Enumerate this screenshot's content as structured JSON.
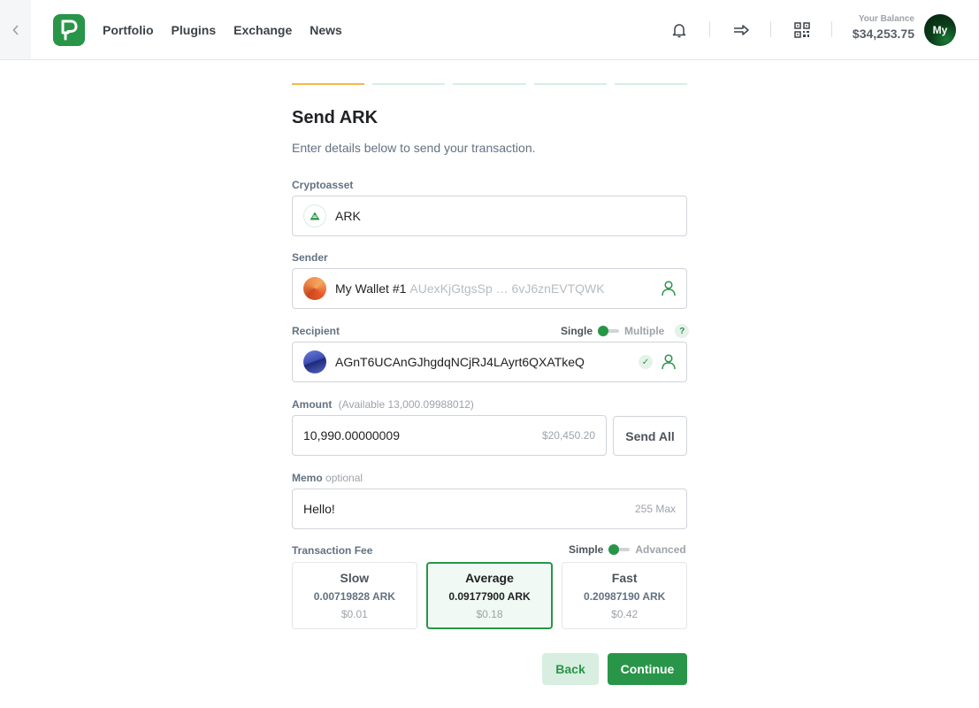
{
  "header": {
    "nav": [
      "Portfolio",
      "Plugins",
      "Exchange",
      "News"
    ],
    "balance_label": "Your Balance",
    "balance_value": "$34,253.75",
    "avatar_initials": "My",
    "brand_color": "#289548"
  },
  "page": {
    "title": "Send ARK",
    "subtitle": "Enter details below to send your transaction.",
    "steps_total": 5,
    "step_active": 1
  },
  "cryptoasset": {
    "label": "Cryptoasset",
    "value": "ARK"
  },
  "sender": {
    "label": "Sender",
    "wallet_name": "My Wallet #1",
    "address": "AUexKjGtgsSp … 6vJ6znEVTQWK"
  },
  "recipient": {
    "label": "Recipient",
    "toggle_on": "Single",
    "toggle_off": "Multiple",
    "help": "?",
    "address": "AGnT6UCAnGJhgdqNCjRJ4LAyrt6QXATkeQ"
  },
  "amount": {
    "label": "Amount",
    "available": "(Available 13,000.09988012)",
    "value": "10,990.00000009",
    "fiat": "$20,450.20",
    "send_all": "Send All"
  },
  "memo": {
    "label": "Memo",
    "optional": "optional",
    "value": "Hello!",
    "max": "255 Max"
  },
  "fee": {
    "label": "Transaction Fee",
    "toggle_on": "Simple",
    "toggle_off": "Advanced",
    "options": [
      {
        "name": "Slow",
        "crypto": "0.00719828 ARK",
        "fiat": "$0.01"
      },
      {
        "name": "Average",
        "crypto": "0.09177900 ARK",
        "fiat": "$0.18"
      },
      {
        "name": "Fast",
        "crypto": "0.20987190 ARK",
        "fiat": "$0.42"
      }
    ]
  },
  "actions": {
    "back": "Back",
    "continue": "Continue"
  }
}
